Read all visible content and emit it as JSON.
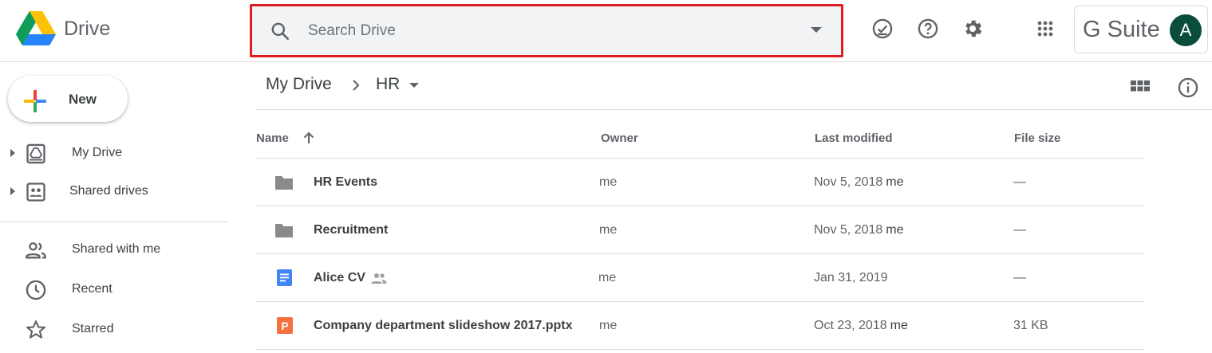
{
  "header": {
    "app_name": "Drive",
    "search": {
      "placeholder": "Search Drive"
    },
    "gsuite_label": "G Suite",
    "avatar_initial": "A"
  },
  "sidebar": {
    "new_label": "New",
    "items": [
      {
        "label": "My Drive"
      },
      {
        "label": "Shared drives"
      },
      {
        "label": "Shared with me"
      },
      {
        "label": "Recent"
      },
      {
        "label": "Starred"
      }
    ]
  },
  "breadcrumb": {
    "root": "My Drive",
    "current": "HR"
  },
  "table": {
    "columns": {
      "name": "Name",
      "owner": "Owner",
      "modified": "Last modified",
      "size": "File size"
    },
    "rows": [
      {
        "name": "HR Events",
        "type": "folder",
        "owner": "me",
        "modified": "Nov 5, 2018",
        "modified_by": "me",
        "size": "—"
      },
      {
        "name": "Recruitment",
        "type": "folder",
        "owner": "me",
        "modified": "Nov 5, 2018",
        "modified_by": "me",
        "size": "—"
      },
      {
        "name": "Alice CV",
        "type": "doc",
        "shared": true,
        "owner": "me",
        "modified": "Jan 31, 2019",
        "modified_by": "",
        "size": "—"
      },
      {
        "name": "Company department slideshow 2017.pptx",
        "type": "pptx",
        "owner": "me",
        "modified": "Oct 23, 2018",
        "modified_by": "me",
        "size": "31 KB"
      }
    ]
  },
  "colors": {
    "search_highlight": "#e01c1c",
    "avatar_bg": "#0b4d3c",
    "doc_blue": "#4285f4",
    "pptx_orange": "#f4703f",
    "folder_gray": "#8a8a8a"
  }
}
